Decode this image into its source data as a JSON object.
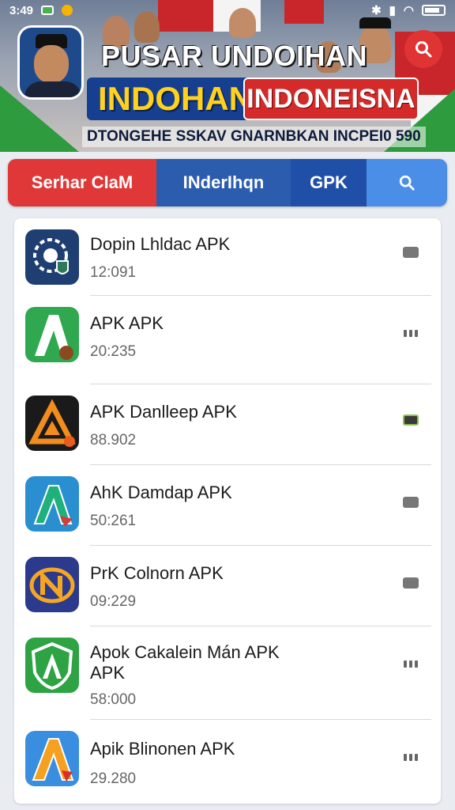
{
  "status_bar": {
    "time": "3:49"
  },
  "header": {
    "title": "PUSAR UNDOIHAN",
    "tag_yellow": "INDOHAN",
    "tag_red": "INDONEISNA",
    "subline": "DTONGEHE SSKAV GNARNBKAN INCPEI0 590"
  },
  "tabs": [
    {
      "label": "Serhar CIaM"
    },
    {
      "label": "INderIhqn"
    },
    {
      "label": "GPK"
    }
  ],
  "apps": [
    {
      "name": "Dopin Lhldac APK",
      "size": "12:091",
      "icon": "shield-gear-icon",
      "action": "box"
    },
    {
      "name": "APK APK",
      "size": "20:235",
      "icon": "green-a-icon",
      "action": "dots"
    },
    {
      "name": "APK Danlleep APK",
      "size": "88.902",
      "icon": "orange-triangle-icon",
      "action": "green"
    },
    {
      "name": "AhK Damdap APK",
      "size": "50:261",
      "icon": "teal-a-icon",
      "action": "box"
    },
    {
      "name": "PrK Colnorn APK",
      "size": "09:229",
      "icon": "orange-n-icon",
      "action": "box"
    },
    {
      "name": "Apok Cakalein Mán APK\nAPK",
      "size": "58:000",
      "icon": "green-shield-a-icon",
      "action": "dots"
    },
    {
      "name": "Apik Blinonen APK",
      "size": "29.280",
      "icon": "orange-a-icon",
      "action": "dots"
    }
  ],
  "colors": {
    "tab_red": "#e03838",
    "tab_blue": "#2c5cad",
    "tab_light_blue": "#4a8ee8",
    "banner_yellow": "#ffd21e",
    "banner_red": "#d42a2a"
  }
}
